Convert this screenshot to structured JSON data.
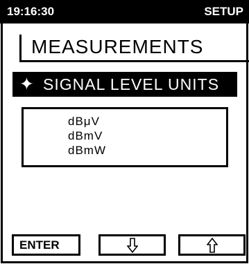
{
  "header": {
    "clock": "19:16:30",
    "mode": "SETUP"
  },
  "page": {
    "title": "MEASUREMENTS"
  },
  "selected": {
    "icon": "four-point-star-icon",
    "glyph": "✦",
    "label": "SIGNAL LEVEL UNITS"
  },
  "options": [
    "dBμV",
    "dBmV",
    "dBmW"
  ],
  "buttons": {
    "enter_label": "ENTER",
    "down_icon": "down-arrow-icon",
    "up_icon": "up-arrow-icon"
  }
}
